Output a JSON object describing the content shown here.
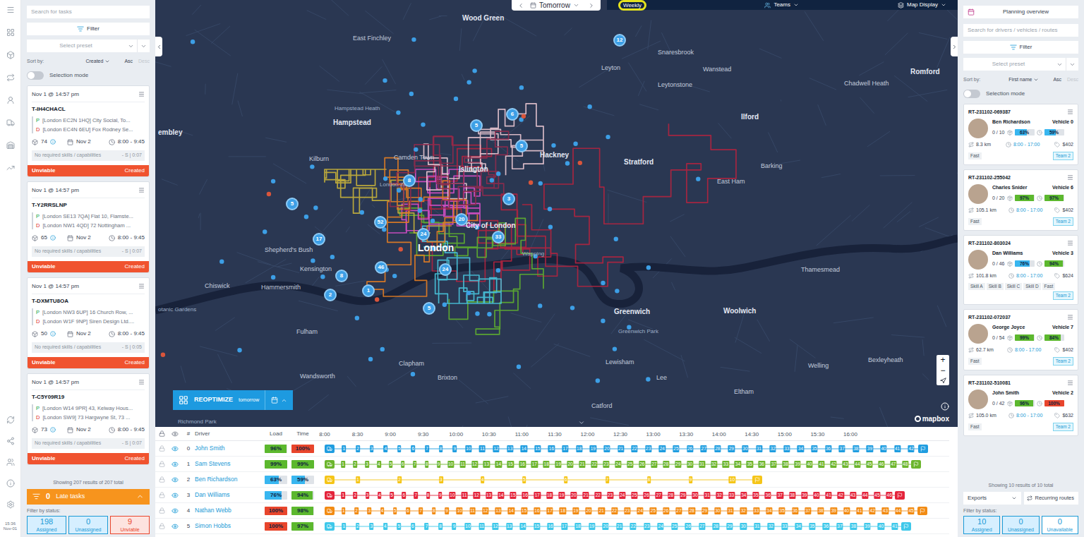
{
  "rail": {
    "clock": "15:36",
    "date": "Nov-01"
  },
  "task_panel": {
    "search_placeholder": "Search for tasks",
    "filter": "Filter",
    "preset_placeholder": "Select preset",
    "sort_label": "Sort by:",
    "sort_value": "Created",
    "order": "Asc",
    "order_alt": "Desc",
    "selection_mode": {
      "label": "Selection mode",
      "on": false
    },
    "pickup_tag": "P",
    "dropoff_tag": "D",
    "tasks": [
      {
        "created": "Nov 1 @ 14:57 pm",
        "id": "T-IH4CHACL",
        "pickup": "[London EC2N 1HQ] City Social, To...",
        "dropoff": "[London EC4N 6EU] Fox Rodney Se...",
        "size": "74",
        "date": "Nov 2",
        "window": "8:00 - 9:45",
        "skills": "No required skills / capabilities",
        "extra": "- S | 0:07",
        "status": "Unviable",
        "state": "Created"
      },
      {
        "created": "Nov 1 @ 14:57 pm",
        "id": "T-Y2RRSLNP",
        "pickup": "[London SE13 7QA] Flat 10, Flamste...",
        "dropoff": "[London NW1 4QD] 72 Nottingham ...",
        "size": "65",
        "date": "Nov 2",
        "window": "8:00 - 9:45",
        "skills": "No required skills / capabilities",
        "extra": "- S | 0:07",
        "status": "Unviable",
        "state": "Created"
      },
      {
        "created": "Nov 1 @ 14:57 pm",
        "id": "T-DXMTU8OA",
        "pickup": "[London NW3 6UP] 16 Church Row, ...",
        "dropoff": "[London W1F 9NP] Siren Design Ltd....",
        "size": "50",
        "date": "Nov 2",
        "window": "8:00 - 9:45",
        "skills": "No required skills / capabilities",
        "extra": "- S | 0:05",
        "status": "Unviable",
        "state": "Created"
      },
      {
        "created": "Nov 1 @ 14:57 pm",
        "id": "T-C5Y09R19",
        "pickup": "[London W14 9PR] 43, Kelway Hous...",
        "dropoff": "[London SW9] 73 Hargwyne St, 73 ...",
        "size": "73",
        "date": "Nov 2",
        "window": "8:00 - 9:45",
        "skills": "No required skills / capabilities",
        "extra": "- S | 0:07",
        "status": "Unviable",
        "state": "Created"
      }
    ],
    "showing": "Showing 207 results of 207 total",
    "late": {
      "count": "0",
      "label": "Late tasks"
    },
    "status_label": "Filter by status:",
    "statuses": [
      {
        "count": "198",
        "label": "Assigned",
        "color": "#1a9ad6",
        "selected": true
      },
      {
        "count": "0",
        "label": "Unassigned",
        "color": "#1a9ad6",
        "selected": true
      },
      {
        "count": "9",
        "label": "Unviable",
        "color": "#e8452c",
        "selected": true
      }
    ]
  },
  "map": {
    "date": "Tomorrow",
    "view": "Weekly",
    "teams": "Teams",
    "display": "Map Display",
    "reoptimize": {
      "label": "REOPTIMIZE",
      "when": "tomorrow"
    },
    "attribution": "mapbox",
    "zoom_in": "+",
    "zoom_out": "−",
    "places": [
      {
        "name": "Wood Green",
        "kind": "town"
      },
      {
        "name": "East Finchley",
        "kind": "district"
      },
      {
        "name": "Snaresbrook",
        "kind": "district"
      },
      {
        "name": "Wanstead",
        "kind": "district"
      },
      {
        "name": "Romford",
        "kind": "town"
      },
      {
        "name": "Leyton",
        "kind": "district"
      },
      {
        "name": "Leytonstone",
        "kind": "district"
      },
      {
        "name": "Chadwell Heath",
        "kind": "district"
      },
      {
        "name": "Hampstead Heath",
        "kind": "park"
      },
      {
        "name": "Hampstead",
        "kind": "town"
      },
      {
        "name": "Ilford",
        "kind": "town"
      },
      {
        "name": "embley",
        "kind": "town"
      },
      {
        "name": "Kilburn",
        "kind": "district"
      },
      {
        "name": "Camden Town",
        "kind": "district"
      },
      {
        "name": "Islington",
        "kind": "town"
      },
      {
        "name": "Hackney",
        "kind": "town"
      },
      {
        "name": "Stratford",
        "kind": "town"
      },
      {
        "name": "Barking",
        "kind": "district"
      },
      {
        "name": "East Ham",
        "kind": "district"
      },
      {
        "name": "London Zoo",
        "kind": "park"
      },
      {
        "name": "City of London",
        "kind": "town"
      },
      {
        "name": "London",
        "kind": "major"
      },
      {
        "name": "Shepherd's Bush",
        "kind": "district"
      },
      {
        "name": "Wapping",
        "kind": "park"
      },
      {
        "name": "Kensington",
        "kind": "district"
      },
      {
        "name": "Thamesmead",
        "kind": "district"
      },
      {
        "name": "Chiswick",
        "kind": "district"
      },
      {
        "name": "Hammersmith",
        "kind": "district"
      },
      {
        "name": "otanic Gardens",
        "kind": "park"
      },
      {
        "name": "Greenwich",
        "kind": "town"
      },
      {
        "name": "Woolwich",
        "kind": "town"
      },
      {
        "name": "Greenwich Park",
        "kind": "park"
      },
      {
        "name": "Fulham",
        "kind": "district"
      },
      {
        "name": "Bexleyheath",
        "kind": "district"
      },
      {
        "name": "Lewisham",
        "kind": "district"
      },
      {
        "name": "Clapham",
        "kind": "district"
      },
      {
        "name": "Welling",
        "kind": "district"
      },
      {
        "name": "Brixton",
        "kind": "district"
      },
      {
        "name": "Wandsworth",
        "kind": "district"
      },
      {
        "name": "Lee",
        "kind": "district"
      },
      {
        "name": "Eltham",
        "kind": "district"
      },
      {
        "name": "Catford",
        "kind": "district"
      },
      {
        "name": "Richmond Park",
        "kind": "park"
      }
    ],
    "pins": [
      {
        "label": "12"
      },
      {
        "label": "6"
      },
      {
        "label": "5"
      },
      {
        "label": "5"
      },
      {
        "label": "8"
      },
      {
        "label": "3"
      },
      {
        "label": "5"
      },
      {
        "label": "52"
      },
      {
        "label": "20"
      },
      {
        "label": "24"
      },
      {
        "label": "33"
      },
      {
        "label": "17"
      },
      {
        "label": "46"
      },
      {
        "label": "24"
      },
      {
        "label": "8"
      },
      {
        "label": "1"
      },
      {
        "label": "5"
      },
      {
        "label": "2"
      }
    ],
    "routes": [
      {
        "color": "#b3233f"
      },
      {
        "color": "#5fb02f"
      },
      {
        "color": "#d64fc8"
      },
      {
        "color": "#e9c6d2"
      },
      {
        "color": "#c8b33a"
      },
      {
        "color": "#48c4dc"
      },
      {
        "color": "#e67e22"
      },
      {
        "color": "#8e2b4d"
      }
    ]
  },
  "timeline": {
    "columns": {
      "number": "#",
      "driver": "Driver",
      "load": "Load",
      "time": "Time"
    },
    "ticks": [
      "8:00",
      "8:30",
      "9:00",
      "9:30",
      "10:00",
      "10:30",
      "11:00",
      "11:30",
      "12:00",
      "12:30",
      "13:00",
      "13:30",
      "14:00",
      "14:30",
      "15:00",
      "15:30",
      "16:00"
    ],
    "rows": [
      {
        "number": "0",
        "driver": "John Smith",
        "locked": false,
        "visible": true,
        "color": "#1f9de0",
        "level": 0.966,
        "load": {
          "text": "96%",
          "level": 0.96,
          "color": "#5cb82e"
        },
        "time": {
          "text": "100%",
          "level": 1,
          "color": "#e8452c"
        },
        "stops": [
          "1",
          "2",
          "3",
          "4",
          "5",
          "6",
          "7",
          "8",
          "9",
          "10",
          "11",
          "12",
          "13",
          "14",
          "15",
          "16",
          "17",
          "18",
          "19",
          "20",
          "21",
          "22",
          "23",
          "24",
          "25",
          "26",
          "27",
          "28",
          "29",
          "30",
          "31",
          "32",
          "33",
          "34",
          "35",
          "36",
          "37",
          "38",
          "39",
          "40",
          "41",
          "42"
        ]
      },
      {
        "number": "1",
        "driver": "Sam Stevens",
        "locked": false,
        "visible": true,
        "color": "#6cb52d",
        "level": 0.955,
        "load": {
          "text": "99%",
          "level": 0.99,
          "color": "#5cb82e"
        },
        "time": {
          "text": "99%",
          "level": 0.99,
          "color": "#5cb82e"
        },
        "stops": [
          "1",
          "2",
          "3",
          "4",
          "5",
          "6",
          "7",
          "8",
          "9",
          "10",
          "11",
          "12",
          "13",
          "14",
          "15",
          "16",
          "17",
          "18",
          "19",
          "20",
          "21",
          "22",
          "23",
          "24",
          "25",
          "26",
          "27",
          "28",
          "29",
          "30",
          "31",
          "32",
          "33",
          "34",
          "35",
          "36",
          "37",
          "38",
          "39",
          "40",
          "41",
          "42",
          "43",
          "44",
          "45",
          "46",
          "47",
          "48"
        ]
      },
      {
        "number": "2",
        "driver": "Ben Richardson",
        "locked": false,
        "visible": true,
        "color": "#f5c518",
        "level": 0.705,
        "load": {
          "text": "63%",
          "level": 0.63,
          "color": "#38b6f0"
        },
        "time": {
          "text": "59%",
          "level": 0.59,
          "color": "#38b6f0"
        },
        "stops": [
          "1",
          "2",
          "3",
          "4",
          "5",
          "6",
          "7",
          "8",
          "9",
          "10"
        ]
      },
      {
        "number": "3",
        "driver": "Dan Williams",
        "locked": false,
        "visible": true,
        "color": "#e4243b",
        "level": 0.93,
        "load": {
          "text": "76%",
          "level": 0.76,
          "color": "#38b6f0"
        },
        "time": {
          "text": "94%",
          "level": 0.94,
          "color": "#5cb82e"
        },
        "stops": [
          "1",
          "2",
          "3",
          "4",
          "5",
          "6",
          "7",
          "8",
          "9",
          "10",
          "11",
          "12",
          "13",
          "14",
          "15",
          "16",
          "17",
          "18",
          "19",
          "20",
          "21",
          "22",
          "23",
          "24",
          "25",
          "26",
          "27",
          "28",
          "29",
          "30",
          "31",
          "32",
          "33",
          "34",
          "35",
          "36",
          "37",
          "38",
          "39",
          "40",
          "41",
          "42",
          "43",
          "44",
          "45",
          "46"
        ]
      },
      {
        "number": "4",
        "driver": "Nathan Webb",
        "locked": false,
        "visible": true,
        "color": "#f28b13",
        "level": 0.965,
        "load": {
          "text": "100%",
          "level": 1,
          "color": "#e8452c"
        },
        "time": {
          "text": "98%",
          "level": 0.98,
          "color": "#5cb82e"
        },
        "stops": [
          "1",
          "2",
          "3",
          "4",
          "5",
          "6",
          "7",
          "8",
          "9",
          "10",
          "11",
          "12",
          "13",
          "14",
          "15",
          "16",
          "17",
          "18",
          "19",
          "20",
          "21",
          "22",
          "23",
          "24",
          "25",
          "26",
          "27",
          "28",
          "29",
          "30",
          "31",
          "32",
          "33",
          "34",
          "35",
          "36",
          "37",
          "38",
          "39",
          "40",
          "41",
          "42",
          "43",
          "44",
          "45"
        ]
      },
      {
        "number": "5",
        "driver": "Simon Hobbs",
        "locked": false,
        "visible": true,
        "color": "#3ec8ea",
        "level": 0.94,
        "load": {
          "text": "100%",
          "level": 1,
          "color": "#e8452c"
        },
        "time": {
          "text": "97%",
          "level": 0.97,
          "color": "#5cb82e"
        },
        "stops": [
          "1",
          "2",
          "3",
          "4",
          "5",
          "6",
          "7",
          "8",
          "9",
          "10",
          "11",
          "12",
          "13",
          "14",
          "15",
          "16",
          "17",
          "18",
          "19",
          "20",
          "21",
          "22",
          "23",
          "24",
          "25",
          "26",
          "27",
          "28",
          "29",
          "30",
          "31",
          "32",
          "33",
          "34",
          "35",
          "36",
          "37",
          "38",
          "39",
          "40",
          "41"
        ]
      }
    ]
  },
  "route_panel": {
    "overview": "Planning overview",
    "search_placeholder": "Search for drivers / vehicles / routes",
    "filter": "Filter",
    "preset_placeholder": "Select preset",
    "sort_label": "Sort by:",
    "sort_value": "First name",
    "order": "Asc",
    "order_alt": "Desc",
    "selection_mode": {
      "label": "Selection mode",
      "on": false
    },
    "routes": [
      {
        "id": "RT-231102-069387",
        "driver": "Ben Richardson",
        "vehicle": "Vehicle 0",
        "stops": "0 / 10",
        "load": {
          "text": "63%",
          "level": 0.63,
          "color": "#38b6f0"
        },
        "time": {
          "text": "59%",
          "level": 0.59,
          "color": "#38b6f0"
        },
        "distance": "8.3 km",
        "hours": "8:00 - 17:00",
        "cost": "$402",
        "tags": [
          "Fast"
        ],
        "team": "Team 2"
      },
      {
        "id": "RT-231102-255042",
        "driver": "Charles Snider",
        "vehicle": "Vehicle 6",
        "stops": "0 / 20",
        "load": {
          "text": "97%",
          "level": 0.97,
          "color": "#5cb82e"
        },
        "time": {
          "text": "97%",
          "level": 0.97,
          "color": "#5cb82e"
        },
        "distance": "105.1 km",
        "hours": "8:00 - 17:00",
        "cost": "$402",
        "tags": [
          "Fast"
        ],
        "team": "Team 2"
      },
      {
        "id": "RT-231102-803024",
        "driver": "Dan Williams",
        "vehicle": "Vehicle 3",
        "stops": "0 / 46",
        "load": {
          "text": "76%",
          "level": 0.76,
          "color": "#38b6f0"
        },
        "time": {
          "text": "94%",
          "level": 0.94,
          "color": "#5cb82e"
        },
        "distance": "101.8 km",
        "hours": "8:00 - 17:00",
        "cost": "$624",
        "tags": [
          "Skill A",
          "Skill B",
          "Skill C",
          "Skill D",
          "Fast"
        ],
        "team": "Team 2"
      },
      {
        "id": "RT-231102-072037",
        "driver": "George Joyce",
        "vehicle": "Vehicle 7",
        "stops": "0 / 54",
        "load": {
          "text": "99%",
          "level": 0.99,
          "color": "#5cb82e"
        },
        "time": {
          "text": "84%",
          "level": 0.84,
          "color": "#5cb82e"
        },
        "distance": "62.7 km",
        "hours": "8:00 - 17:00",
        "cost": "$402",
        "tags": [
          "Fast"
        ],
        "team": "Team 2"
      },
      {
        "id": "RT-231102-510081",
        "driver": "John Smith",
        "vehicle": "Vehicle 2",
        "stops": "0 / 42",
        "load": {
          "text": "96%",
          "level": 0.96,
          "color": "#5cb82e"
        },
        "time": {
          "text": "100%",
          "level": 1,
          "color": "#e8452c"
        },
        "distance": "105.0 km",
        "hours": "8:00 - 17:00",
        "cost": "$632",
        "tags": [
          "Fast"
        ],
        "team": "Team 2"
      }
    ],
    "showing": "Showing 10 results of 10 total",
    "exports": "Exports",
    "recurring": "Recurring routes",
    "status_label": "Filter by status:",
    "statuses": [
      {
        "count": "10",
        "label": "Assigned",
        "color": "#1a9ad6",
        "selected": true
      },
      {
        "count": "0",
        "label": "Unassigned",
        "color": "#1a9ad6",
        "selected": true
      },
      {
        "count": "0",
        "label": "Unavailable",
        "color": "#1a9ad6",
        "selected": false
      }
    ]
  }
}
